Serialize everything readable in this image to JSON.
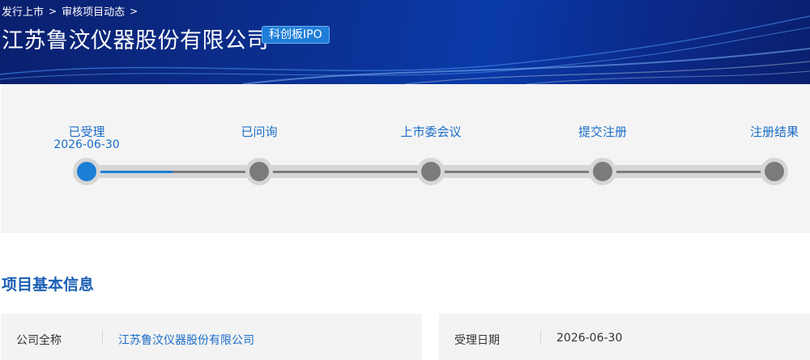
{
  "breadcrumb": {
    "items": [
      "发行上市",
      "审核项目动态"
    ],
    "separator": ">"
  },
  "company": {
    "name": "江苏鲁汶仪器股份有限公司",
    "board_badge": "科创板IPO"
  },
  "progress": {
    "current_step_fraction": 0.25,
    "steps": [
      {
        "label": "已受理",
        "date": "2026-06-30",
        "active": true
      },
      {
        "label": "已问询",
        "date": "",
        "active": false
      },
      {
        "label": "上市委会议",
        "date": "",
        "active": false
      },
      {
        "label": "提交注册",
        "date": "",
        "active": false
      },
      {
        "label": "注册结果",
        "date": "",
        "active": false
      }
    ]
  },
  "section": {
    "title": "项目基本信息"
  },
  "info": {
    "company_full_name_label": "公司全称",
    "company_full_name_value": "江苏鲁汶仪器股份有限公司",
    "accept_date_label": "受理日期",
    "accept_date_value": "2026-06-30"
  },
  "colors": {
    "accent": "#1a6dc8",
    "active_node": "#1b7fd6",
    "inactive_node": "#7b7b7b",
    "banner_dark": "#0a1f6e"
  }
}
